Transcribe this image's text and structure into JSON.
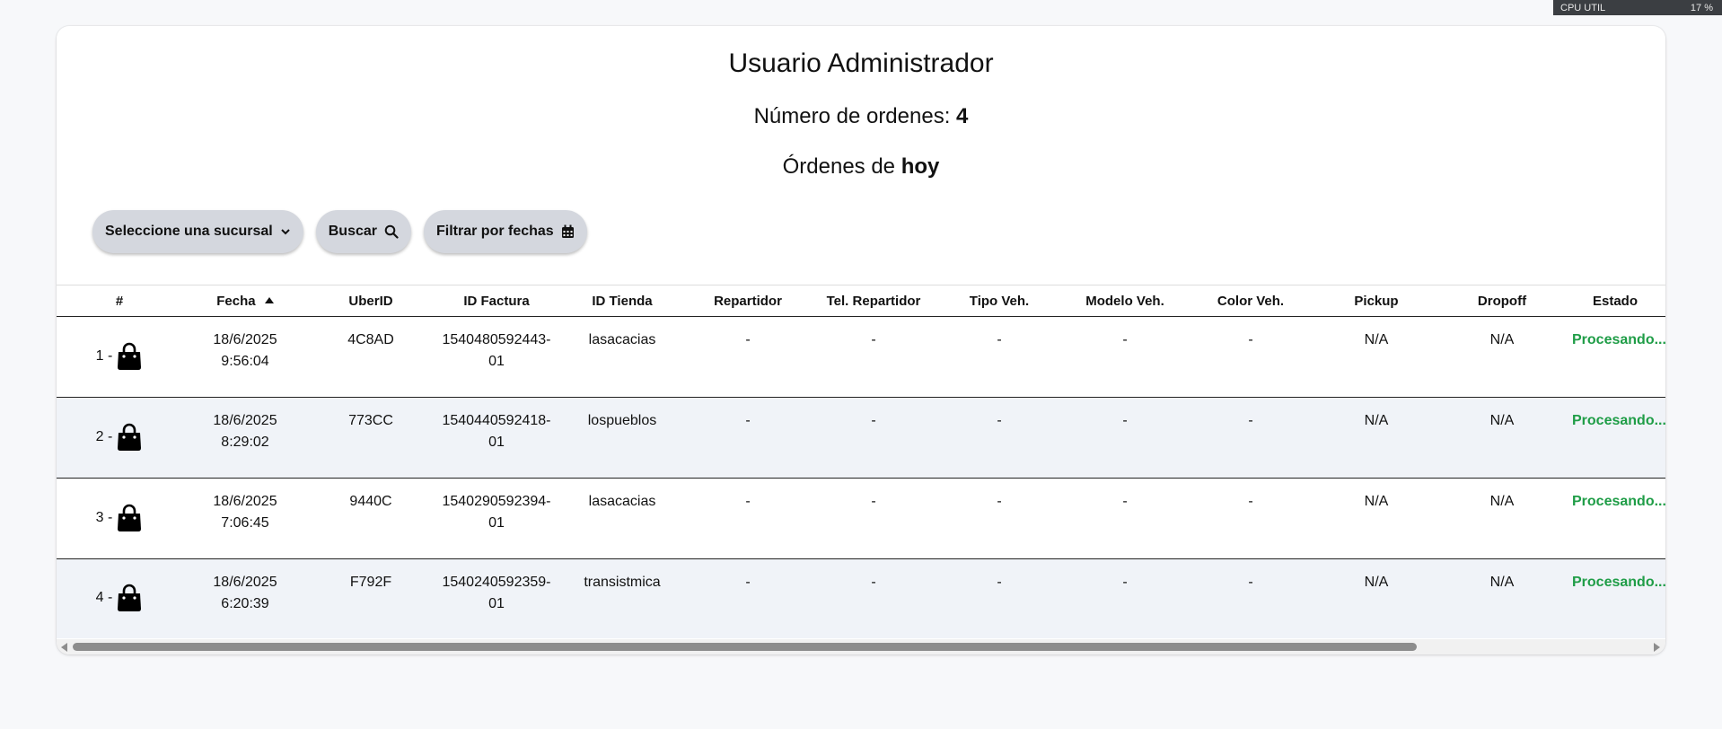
{
  "system": {
    "cpu_label": "CPU UTIL",
    "cpu_value": "17 %"
  },
  "header": {
    "title": "Usuario Administrador",
    "count_label": "Número de ordenes:",
    "count_value": "4",
    "orders_label": "Órdenes de",
    "orders_when": "hoy"
  },
  "controls": {
    "branch_select": "Seleccione una sucursal",
    "search_button": "Buscar",
    "date_filter_button": "Filtrar por fechas"
  },
  "table": {
    "columns": [
      "#",
      "Fecha",
      "UberID",
      "ID Factura",
      "ID Tienda",
      "Repartidor",
      "Tel. Repartidor",
      "Tipo Veh.",
      "Modelo Veh.",
      "Color Veh.",
      "Pickup",
      "Dropoff",
      "Estado"
    ],
    "rows": [
      {
        "num": "1 -",
        "date": "18/6/2025",
        "time": "9:56:04",
        "uber_id": "4C8AD",
        "invoice_1": "1540480592443-",
        "invoice_2": "01",
        "store": "lasacacias",
        "driver": "-",
        "phone": "-",
        "vehicle_type": "-",
        "vehicle_model": "-",
        "vehicle_color": "-",
        "pickup": "N/A",
        "dropoff": "N/A",
        "status": "Procesando..."
      },
      {
        "num": "2 -",
        "date": "18/6/2025",
        "time": "8:29:02",
        "uber_id": "773CC",
        "invoice_1": "1540440592418-",
        "invoice_2": "01",
        "store": "lospueblos",
        "driver": "-",
        "phone": "-",
        "vehicle_type": "-",
        "vehicle_model": "-",
        "vehicle_color": "-",
        "pickup": "N/A",
        "dropoff": "N/A",
        "status": "Procesando..."
      },
      {
        "num": "3 -",
        "date": "18/6/2025",
        "time": "7:06:45",
        "uber_id": "9440C",
        "invoice_1": "1540290592394-",
        "invoice_2": "01",
        "store": "lasacacias",
        "driver": "-",
        "phone": "-",
        "vehicle_type": "-",
        "vehicle_model": "-",
        "vehicle_color": "-",
        "pickup": "N/A",
        "dropoff": "N/A",
        "status": "Procesando..."
      },
      {
        "num": "4 -",
        "date": "18/6/2025",
        "time": "6:20:39",
        "uber_id": "F792F",
        "invoice_1": "1540240592359-",
        "invoice_2": "01",
        "store": "transistmica",
        "driver": "-",
        "phone": "-",
        "vehicle_type": "-",
        "vehicle_model": "-",
        "vehicle_color": "-",
        "pickup": "N/A",
        "dropoff": "N/A",
        "status": "Procesando..."
      }
    ]
  },
  "colors": {
    "status_green": "#1f9d47",
    "button_bg": "#d4d7de",
    "row_alt": "#f0f3f8"
  },
  "icons": {
    "row_icon": "shopping-bag-icon",
    "sort": "sort-asc-icon",
    "search": "search-icon",
    "calendar": "calendar-icon",
    "select": "chevron-down-icon"
  }
}
